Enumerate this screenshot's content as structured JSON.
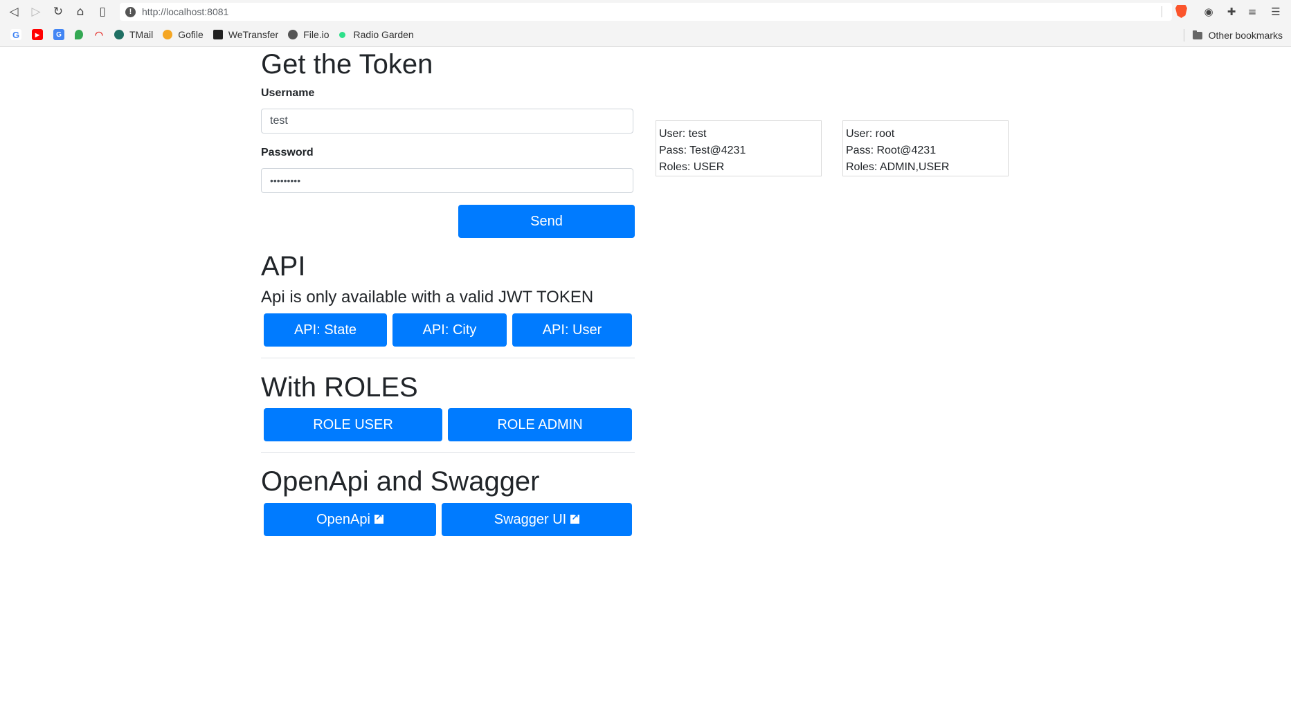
{
  "browser": {
    "url": "http://localhost:8081",
    "bookmarks": [
      "TMail",
      "Gofile",
      "WeTransfer",
      "File.io",
      "Radio Garden"
    ],
    "other_bookmarks": "Other bookmarks"
  },
  "token_section": {
    "title": "Get the Token",
    "username_label": "Username",
    "username_value": "test",
    "password_label": "Password",
    "password_value": "•••••••••",
    "send_label": "Send"
  },
  "credentials": [
    {
      "user": "User: test",
      "pass": "Pass: Test@4231",
      "roles": "Roles: USER"
    },
    {
      "user": "User: root",
      "pass": "Pass: Root@4231",
      "roles": "Roles: ADMIN,USER"
    }
  ],
  "api_section": {
    "title": "API",
    "description": "Api is only available with a valid JWT TOKEN",
    "buttons": [
      "API: State",
      "API: City",
      "API: User"
    ]
  },
  "roles_section": {
    "title": "With ROLES",
    "buttons": [
      "ROLE USER",
      "ROLE ADMIN"
    ]
  },
  "openapi_section": {
    "title": "OpenApi and Swagger",
    "buttons": [
      "OpenApi",
      "Swagger UI"
    ]
  },
  "colors": {
    "primary": "#007bff",
    "text": "#212529"
  }
}
